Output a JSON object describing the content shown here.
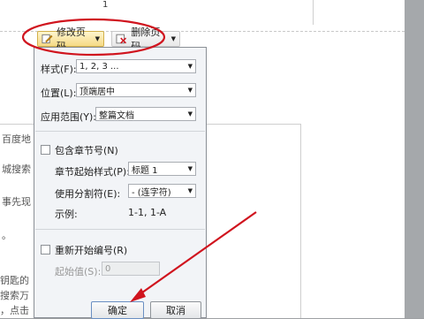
{
  "document": {
    "page_number": "1",
    "lines": [
      "百度地",
      "城搜索",
      "事先现",
      "。",
      "钥匙的",
      "搜索万",
      "，点击"
    ]
  },
  "toolbar": {
    "modify_label": "修改页码",
    "delete_label": "删除页码"
  },
  "dialog": {
    "style_label": "样式(F):",
    "style_value": "1, 2, 3 ...",
    "position_label": "位置(L):",
    "position_value": "顶端居中",
    "apply_label": "应用范围(Y):",
    "apply_value": "整篇文档",
    "include_chapter_label": "包含章节号(N)",
    "chapter_style_label": "章节起始样式(P):",
    "chapter_style_value": "标题 1",
    "separator_label": "使用分割符(E):",
    "separator_value": "-    (连字符)",
    "example_label": "示例:",
    "example_value": "1-1, 1-A",
    "restart_label": "重新开始编号(R)",
    "start_value_label": "起始值(S):",
    "start_value": "0",
    "ok_label": "确定",
    "cancel_label": "取消"
  },
  "annotation_colors": {
    "highlight": "#d0141e"
  }
}
